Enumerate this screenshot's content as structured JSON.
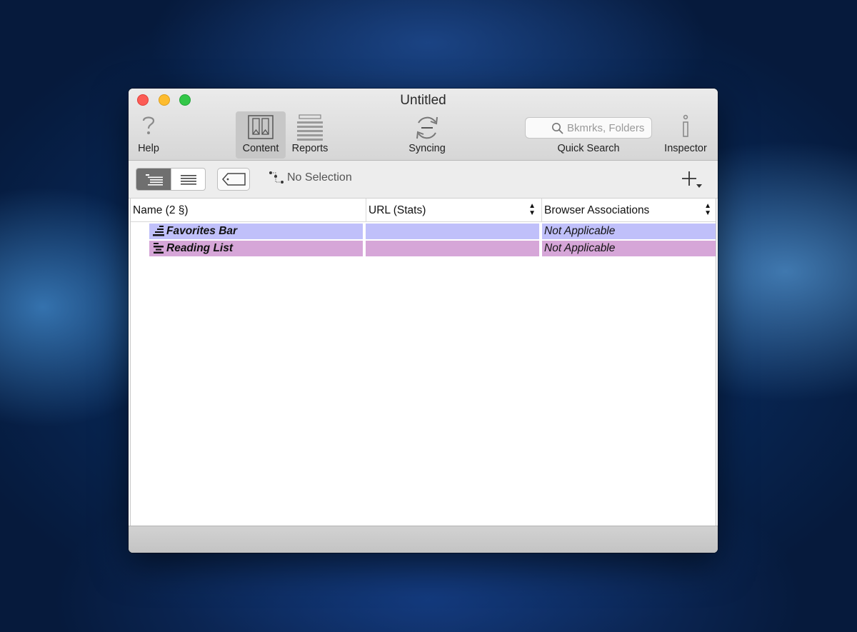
{
  "window": {
    "title": "Untitled"
  },
  "toolbar": {
    "help_label": "Help",
    "content_label": "Content",
    "reports_label": "Reports",
    "syncing_label": "Syncing",
    "quick_search_label": "Quick Search",
    "search_placeholder": "Bkmrks, Folders",
    "inspector_label": "Inspector"
  },
  "subbar": {
    "selection_text": "No Selection"
  },
  "table": {
    "columns": [
      "Name  (2 §)",
      "URL (Stats)",
      "Browser Associations"
    ],
    "rows": [
      {
        "name": "Favorites Bar",
        "url": "",
        "assoc": "Not Applicable",
        "color": "#c0c0fa"
      },
      {
        "name": "Reading List",
        "url": "",
        "assoc": "Not Applicable",
        "color": "#d6a6d8"
      }
    ]
  },
  "colors": {
    "active_tab": "#c7c7c7",
    "row_blue": "#c0c0fa",
    "row_pink": "#d6a6d8"
  },
  "icons": [
    "help-icon",
    "content-icon",
    "reports-icon",
    "syncing-icon",
    "search-icon",
    "inspector-icon",
    "outline-view-icon",
    "list-view-icon",
    "tag-icon",
    "hierarchy-icon",
    "add-icon",
    "folder-bar-icon"
  ]
}
